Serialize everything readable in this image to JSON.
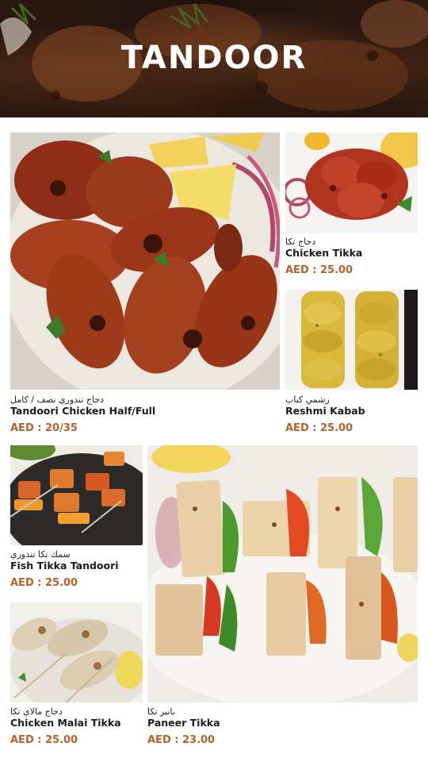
{
  "header": {
    "title": "TANDOOR"
  },
  "items": [
    {
      "arabic": "دجاج تندوري نصف / كامل",
      "name": "Tandoori Chicken Half/Full",
      "price": "AED : 20/35",
      "photo": "tandoori-chicken-photo"
    },
    {
      "arabic": "دجاج تكا",
      "name": "Chicken Tikka",
      "price": "AED : 25.00",
      "photo": "chicken-tikka-photo"
    },
    {
      "arabic": "رشمي كباب",
      "name": "Reshmi Kabab",
      "price": "AED : 25.00",
      "photo": "reshmi-kabab-photo"
    },
    {
      "arabic": "سمك تكا تندوري",
      "name": "Fish Tikka Tandoori",
      "price": "AED : 25.00",
      "photo": "fish-tikka-photo"
    },
    {
      "arabic": "دجاج مالاي تكا",
      "name": "Chicken Malai Tikka",
      "price": "AED : 25.00",
      "photo": "chicken-malai-tikka-photo"
    },
    {
      "arabic": "بانير تكا",
      "name": "Paneer Tikka",
      "price": "AED : 23.00",
      "photo": "paneer-tikka-photo"
    }
  ],
  "colors": {
    "price": "#b5622c",
    "header_overlay": "#2c1a12",
    "title": "#ffffff"
  }
}
